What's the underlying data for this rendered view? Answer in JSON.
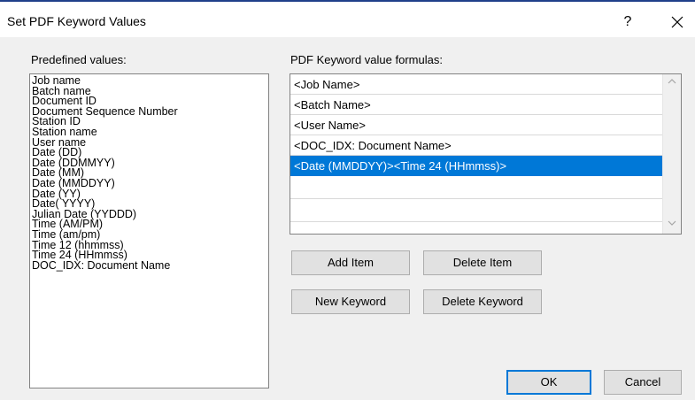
{
  "window": {
    "title": "Set PDF Keyword Values",
    "help_label": "?",
    "close_label": "✕"
  },
  "predefined": {
    "label": "Predefined values:",
    "items": [
      "Job name",
      "Batch name",
      "Document ID",
      "Document Sequence Number",
      "Station ID",
      "Station name",
      "User name",
      "Date (DD)",
      "Date (DDMMYY)",
      "Date (MM)",
      "Date (MMDDYY)",
      "Date (YY)",
      "Date( YYYY)",
      "Julian Date (YYDDD)",
      "Time (AM/PM)",
      "Time (am/pm)",
      "Time 12 (hhmmss)",
      "Time 24 (HHmmss)",
      "DOC_IDX: Document Name"
    ]
  },
  "formulas": {
    "label": "PDF Keyword value formulas:",
    "items": [
      "<Job Name>",
      "<Batch Name>",
      "<User Name>",
      "<DOC_IDX: Document Name>",
      "<Date (MMDDYY)><Time 24 (HHmmss)>"
    ],
    "selected_index": 4
  },
  "buttons": {
    "add_item": "Add Item",
    "delete_item": "Delete Item",
    "new_keyword": "New Keyword",
    "delete_keyword": "Delete Keyword",
    "ok": "OK",
    "cancel": "Cancel"
  },
  "icons": {
    "scroll_up": "chevron-up-icon",
    "scroll_down": "chevron-down-icon"
  },
  "colors": {
    "selection": "#0078d7",
    "titlebar_accent": "#1f3f8a"
  }
}
